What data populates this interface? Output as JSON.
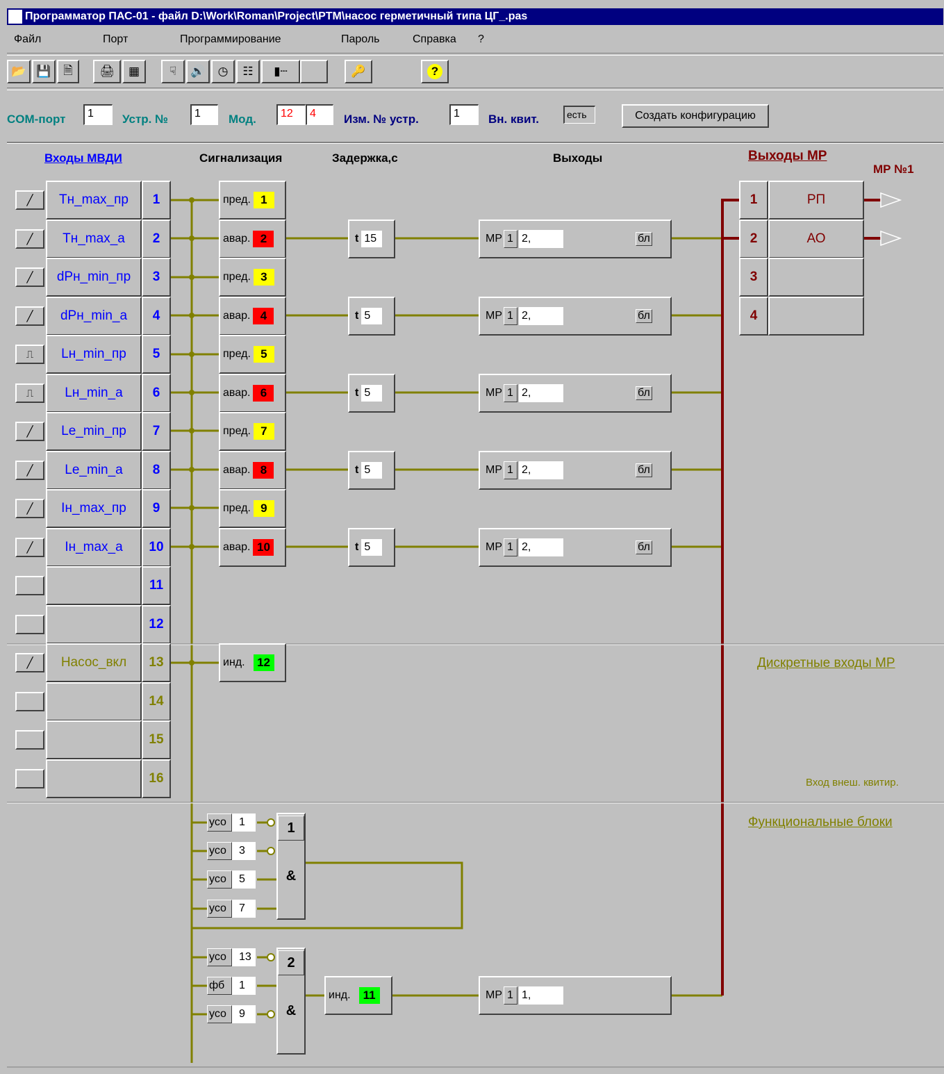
{
  "title": "Программатор ПАС-01 - файл D:\\Work\\Roman\\Project\\PTM\\насос герметичный типа ЦГ_.pas",
  "menu": [
    "Файл",
    "Порт",
    "Программирование",
    "Пароль",
    "Справка",
    "?"
  ],
  "params": {
    "com_label": "COM-порт",
    "com_value": "1",
    "dev_label": "Устр. №",
    "dev_value": "1",
    "mod_label": "Мод.",
    "mod_value1": "12",
    "mod_value2": "4",
    "chg_label": "Изм. № устр.",
    "chg_value": "1",
    "ack_label": "Вн. квит.",
    "ack_value": "есть",
    "create_button": "Создать конфигурацию"
  },
  "headers": {
    "inputs": "Входы МВДИ",
    "signal": "Сигнализация",
    "delay": "Задержка,с",
    "outputs": "Выходы",
    "mr_outputs": "Выходы МР",
    "mr_no": "МР №1"
  },
  "inputs": [
    {
      "num": "1",
      "name": "Тн_max_пр",
      "sig": "пред.",
      "lamp": "1",
      "lamp_color": "#ffff00",
      "delay": "",
      "out": false
    },
    {
      "num": "2",
      "name": "Тн_max_а",
      "sig": "авар.",
      "lamp": "2",
      "lamp_color": "#ff0000",
      "delay": "15",
      "out": true
    },
    {
      "num": "3",
      "name": "dPн_min_пр",
      "sig": "пред.",
      "lamp": "3",
      "lamp_color": "#ffff00",
      "delay": "",
      "out": false
    },
    {
      "num": "4",
      "name": "dPн_min_а",
      "sig": "авар.",
      "lamp": "4",
      "lamp_color": "#ff0000",
      "delay": "5",
      "out": true
    },
    {
      "num": "5",
      "name": "Lн_min_пр",
      "sig": "пред.",
      "lamp": "5",
      "lamp_color": "#ffff00",
      "delay": "",
      "out": false
    },
    {
      "num": "6",
      "name": "Lн_min_а",
      "sig": "авар.",
      "lamp": "6",
      "lamp_color": "#ff0000",
      "delay": "5",
      "out": true
    },
    {
      "num": "7",
      "name": "Le_min_пр",
      "sig": "пред.",
      "lamp": "7",
      "lamp_color": "#ffff00",
      "delay": "",
      "out": false
    },
    {
      "num": "8",
      "name": "Le_min_а",
      "sig": "авар.",
      "lamp": "8",
      "lamp_color": "#ff0000",
      "delay": "5",
      "out": true
    },
    {
      "num": "9",
      "name": "Iн_max_пр",
      "sig": "пред.",
      "lamp": "9",
      "lamp_color": "#ffff00",
      "delay": "",
      "out": false
    },
    {
      "num": "10",
      "name": "Iн_max_а",
      "sig": "авар.",
      "lamp": "10",
      "lamp_color": "#ff0000",
      "delay": "5",
      "out": true
    },
    {
      "num": "11",
      "name": "",
      "sig": "",
      "lamp": "",
      "delay": "",
      "out": false
    },
    {
      "num": "12",
      "name": "",
      "sig": "",
      "lamp": "",
      "delay": "",
      "out": false
    }
  ],
  "output_common": {
    "mr": "МР",
    "mr_num": "1",
    "relay": "2,",
    "bl": "бл",
    "t": "t"
  },
  "mr_outputs": [
    {
      "num": "1",
      "name": "РП"
    },
    {
      "num": "2",
      "name": "АО"
    },
    {
      "num": "3",
      "name": ""
    },
    {
      "num": "4",
      "name": ""
    }
  ],
  "mr_inputs": [
    {
      "num": "13",
      "name": "Насос_вкл",
      "sig": "инд.",
      "lamp": "12"
    },
    {
      "num": "14",
      "name": ""
    },
    {
      "num": "15",
      "name": ""
    },
    {
      "num": "16",
      "name": ""
    }
  ],
  "discrete_label": "Дискретные входы МР",
  "ext_ack_label": "Вход внеш. квитир.",
  "func_label": "Функциональные блоки",
  "block1": {
    "num": "1",
    "op": "&",
    "inputs": [
      {
        "tag": "усо",
        "val": "1",
        "inv": true
      },
      {
        "tag": "усо",
        "val": "3",
        "inv": true
      },
      {
        "tag": "усо",
        "val": "5",
        "inv": false
      },
      {
        "tag": "усо",
        "val": "7",
        "inv": false
      }
    ]
  },
  "block2": {
    "num": "2",
    "op": "&",
    "inputs": [
      {
        "tag": "усо",
        "val": "13",
        "inv": true
      },
      {
        "tag": "фб",
        "val": "1",
        "inv": false
      },
      {
        "tag": "усо",
        "val": "9",
        "inv": true
      }
    ],
    "sig": "инд.",
    "lamp": "11",
    "mr": "МР",
    "mr_num": "1",
    "relay": "1,"
  },
  "colors": {
    "blue": "#0000ff",
    "olive": "#808000",
    "darkred": "#800000",
    "green": "#00ff00",
    "yellow": "#ffff00",
    "red": "#ff0000",
    "teal": "#008080"
  }
}
